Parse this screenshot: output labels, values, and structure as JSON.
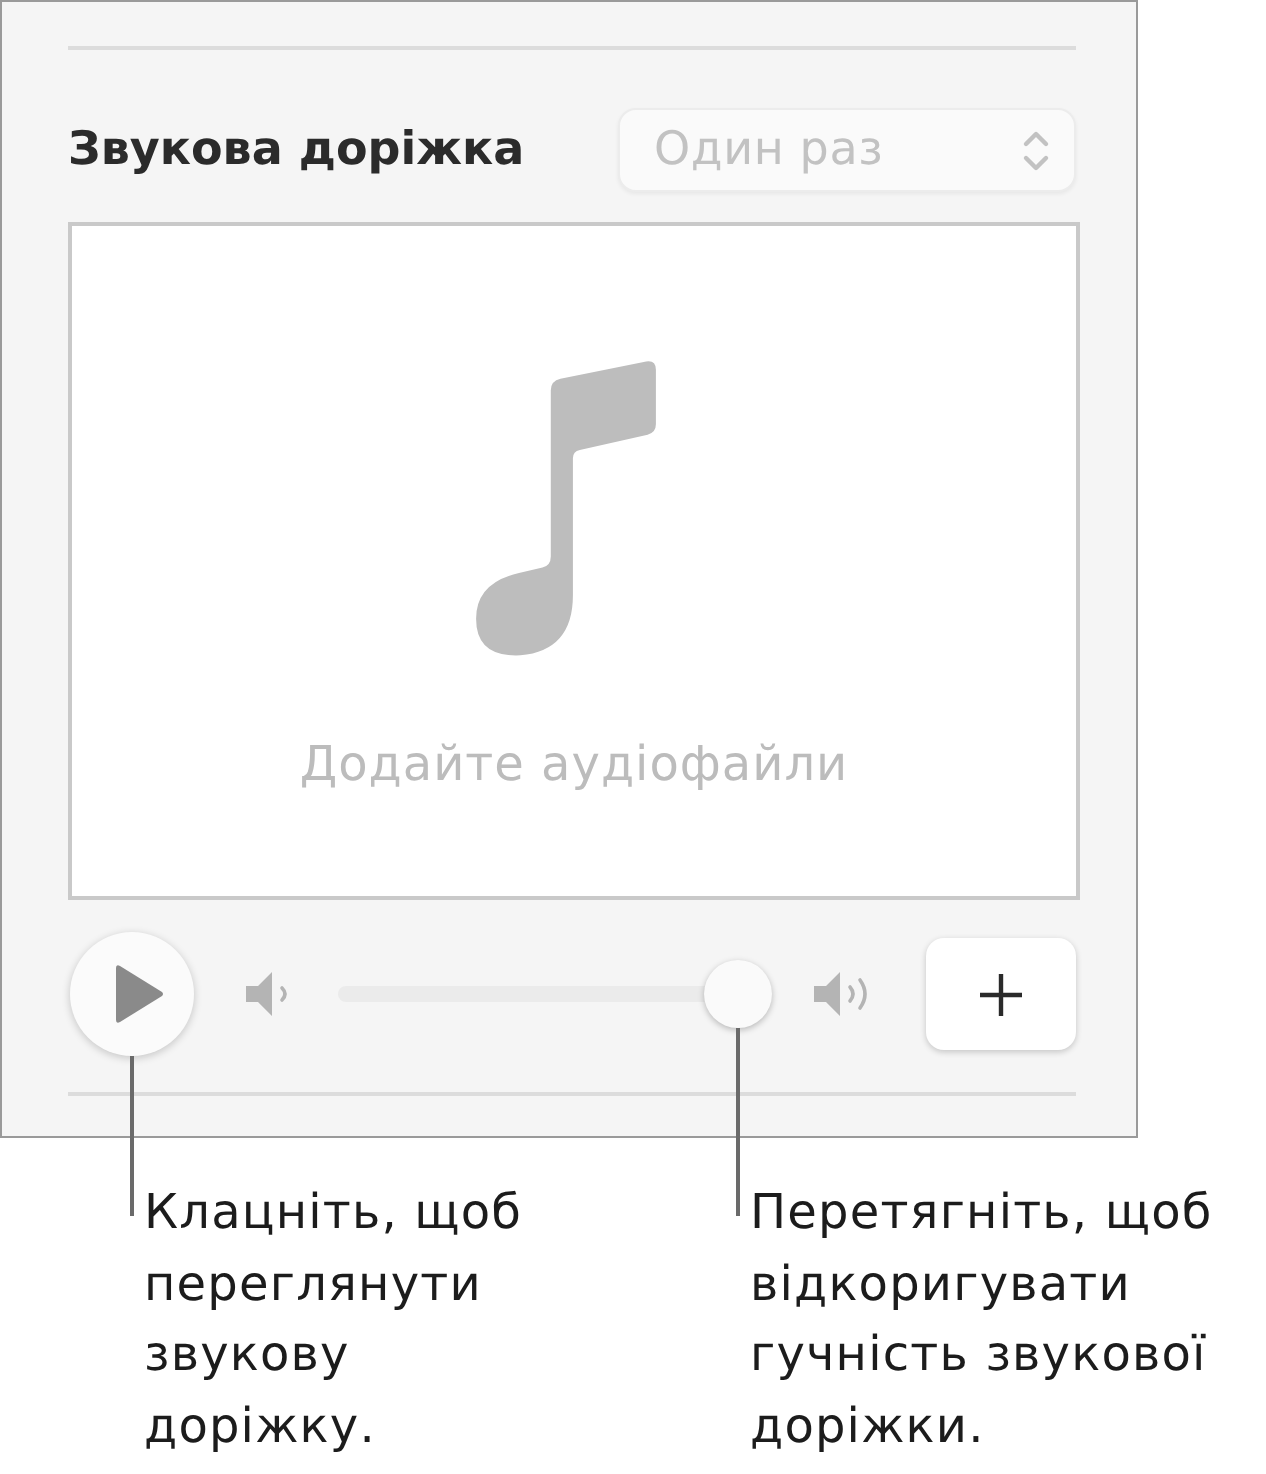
{
  "panel": {
    "title": "Звукова доріжка",
    "repeat_dropdown": {
      "value": "Один раз",
      "disabled": true
    }
  },
  "drop_area": {
    "label": "Додайте аудіофайли"
  },
  "controls": {
    "volume": {
      "level": 1
    }
  },
  "callouts": [
    {
      "kind": "play",
      "text": "Клацніть, щоб переглянути звукову доріжку."
    },
    {
      "kind": "volume",
      "text": "Перетягніть, щоб відкоригувати гучність звукової доріжки."
    }
  ]
}
